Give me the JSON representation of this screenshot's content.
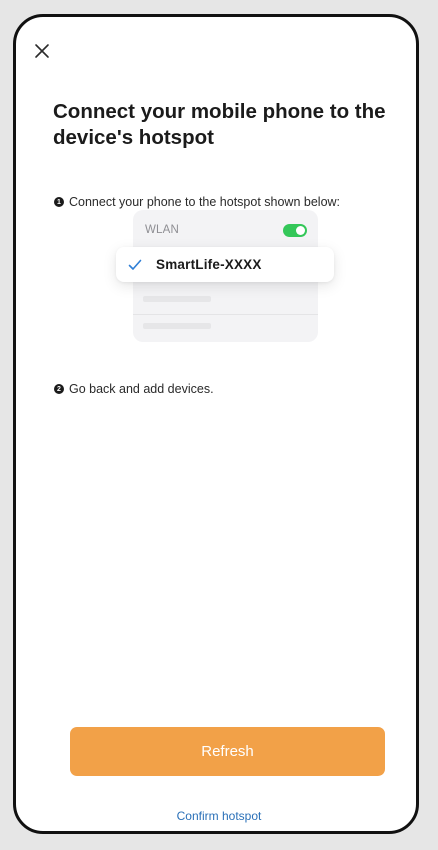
{
  "header": {
    "close_icon": "close-icon"
  },
  "title": "Connect your mobile phone to the device's hotspot",
  "steps": [
    {
      "number": "1",
      "text": "Connect your phone to the hotspot shown below:"
    },
    {
      "number": "2",
      "text": "Go back and add devices."
    }
  ],
  "illustration": {
    "wlan_label": "WLAN",
    "wlan_toggle_on": true,
    "selected_network": "SmartLife-XXXX",
    "check_icon": "checkmark-icon"
  },
  "actions": {
    "refresh_label": "Refresh",
    "confirm_label": "Confirm hotspot"
  },
  "colors": {
    "accent": "#f2a148",
    "link": "#2a70b8",
    "toggle_on": "#34c759"
  }
}
